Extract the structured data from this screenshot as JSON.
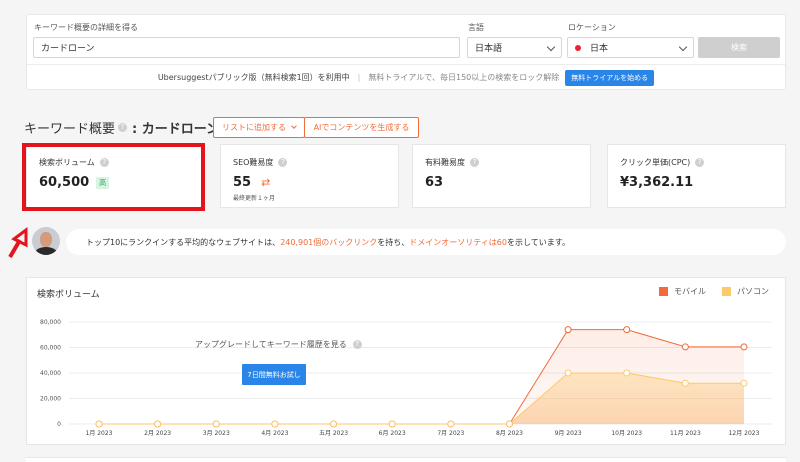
{
  "search": {
    "keyword_label": "キーワード概要の詳細を得る",
    "keyword_value": "カードローン",
    "language_label": "言語",
    "language_value": "日本語",
    "location_label": "ロケーション",
    "location_value": "日本",
    "search_button": "検索"
  },
  "banner": {
    "text1": "Ubersuggestパブリック版（無料検索1回）を利用中",
    "separator": "|",
    "text2": "無料トライアルで、毎日150以上の検索をロック解除",
    "trial_button": "無料トライアルを始める"
  },
  "header": {
    "title_prefix": "キーワード概要",
    "title_keyword": ": カードローン",
    "add_list_button": "リストに追加する",
    "ai_button": "AIでコンテンツを生成する"
  },
  "metrics": [
    {
      "name": "検索ボリューム",
      "value": "60,500",
      "badge": "高"
    },
    {
      "name": "SEO難易度",
      "value": "55",
      "sub": "最終更新１ヶ月"
    },
    {
      "name": "有料難易度",
      "value": "63"
    },
    {
      "name": "クリック単価(CPC)",
      "value": "¥3,362.11"
    }
  ],
  "message": {
    "part1": "トップ10にランクインする平均的なウェブサイトは、",
    "part2": "240,901個のバックリンク",
    "part3": "を持ち、",
    "part4": "ドメインオーソリティは60",
    "part5": "を示しています。"
  },
  "chart_panel": {
    "title": "検索ボリューム",
    "upgrade_text": "アップグレードしてキーワード履歴を見る",
    "try_button": "7日間無料お試し"
  },
  "colors": {
    "accent": "#f26b3a",
    "mobile": "#f26b3a",
    "desktop": "#fdc96a",
    "blue": "#2a85e8",
    "annotation_red": "#e3141b"
  },
  "chart_data": {
    "type": "area",
    "x": [
      "1月 2023",
      "2月 2023",
      "3月 2023",
      "4月 2023",
      "五月 2023",
      "6月 2023",
      "7月 2023",
      "8月 2023",
      "9月 2023",
      "10月 2023",
      "11月 2023",
      "12月 2023"
    ],
    "series": [
      {
        "name": "モバイル",
        "values": [
          0,
          0,
          0,
          0,
          0,
          0,
          0,
          0,
          74000,
          74000,
          60500,
          60500
        ]
      },
      {
        "name": "パソコン",
        "values": [
          0,
          0,
          0,
          0,
          0,
          0,
          0,
          0,
          40000,
          40000,
          32000,
          32000
        ]
      }
    ],
    "yticks": [
      "80,000",
      "60,000",
      "40,000",
      "20,000",
      "0"
    ],
    "ylim": [
      0,
      80000
    ],
    "grid": true,
    "legend": "top-right"
  }
}
